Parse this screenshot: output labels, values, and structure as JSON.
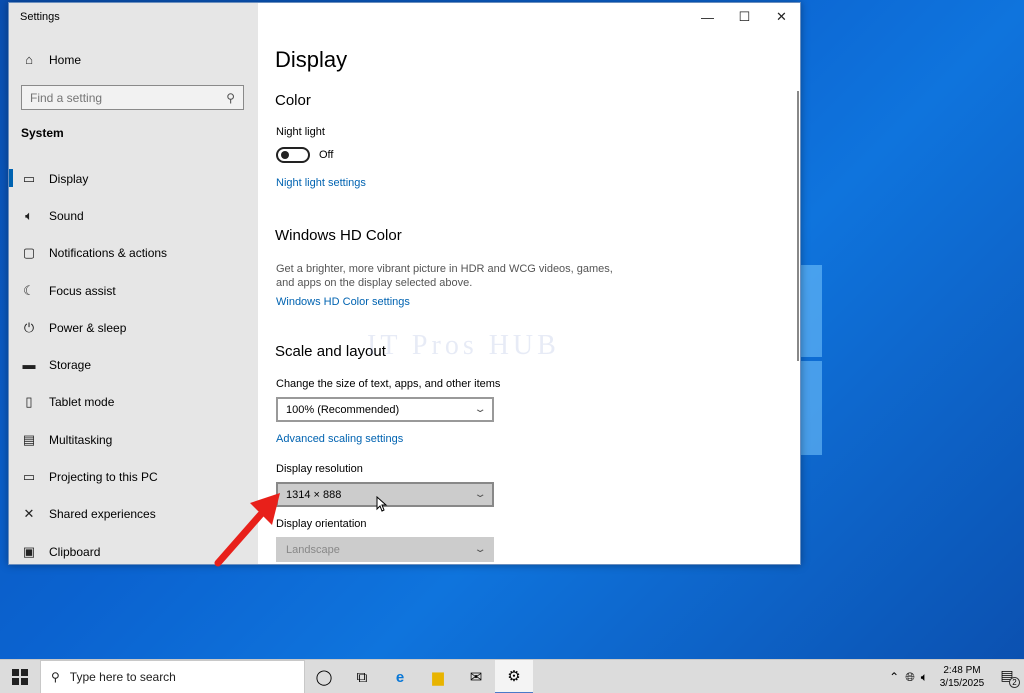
{
  "window": {
    "title": "Settings",
    "minimize": "—",
    "maximize": "☐",
    "close": "✕"
  },
  "sidebar": {
    "home": {
      "icon": "home-icon",
      "label": "Home"
    },
    "search_placeholder": "Find a setting",
    "section": "System",
    "items": [
      {
        "icon": "monitor-icon",
        "label": "Display",
        "active": true
      },
      {
        "icon": "speaker-icon",
        "label": "Sound"
      },
      {
        "icon": "notification-icon",
        "label": "Notifications & actions"
      },
      {
        "icon": "moon-icon",
        "label": "Focus assist"
      },
      {
        "icon": "power-icon",
        "label": "Power & sleep"
      },
      {
        "icon": "storage-icon",
        "label": "Storage"
      },
      {
        "icon": "tablet-icon",
        "label": "Tablet mode"
      },
      {
        "icon": "multitasking-icon",
        "label": "Multitasking"
      },
      {
        "icon": "projector-icon",
        "label": "Projecting to this PC"
      },
      {
        "icon": "shared-icon",
        "label": "Shared experiences"
      },
      {
        "icon": "clipboard-icon",
        "label": "Clipboard"
      }
    ]
  },
  "main": {
    "title": "Display",
    "color": {
      "heading": "Color",
      "night_light_label": "Night light",
      "night_light_state": "Off",
      "night_light_link": "Night light settings"
    },
    "hd_color": {
      "heading": "Windows HD Color",
      "description": "Get a brighter, more vibrant picture in HDR and WCG videos, games, and apps on the display selected above.",
      "link": "Windows HD Color settings"
    },
    "scale": {
      "heading": "Scale and layout",
      "size_label": "Change the size of text, apps, and other items",
      "size_value": "100% (Recommended)",
      "advanced_link": "Advanced scaling settings",
      "resolution_label": "Display resolution",
      "resolution_value": "1314 × 888",
      "orientation_label": "Display orientation",
      "orientation_value": "Landscape"
    },
    "watermark": "IT Pros HUB"
  },
  "taskbar": {
    "search_placeholder": "Type here to search",
    "apps": [
      "cortana-icon",
      "task-view-icon",
      "edge-icon",
      "file-explorer-icon",
      "mail-icon",
      "settings-icon"
    ],
    "time": "2:48 PM",
    "date": "3/15/2025",
    "notification_count": "2"
  },
  "colors": {
    "accent": "#0063b1",
    "sidebar_bg": "#e6e6e6",
    "taskbar_bg": "#dcdcdc"
  }
}
